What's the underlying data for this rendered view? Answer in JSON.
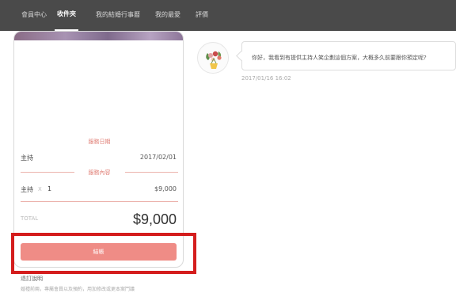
{
  "nav": {
    "items": [
      {
        "label": "會員中心"
      },
      {
        "label": "收件夾"
      },
      {
        "label": "我的結婚行事曆"
      },
      {
        "label": "我的最愛"
      },
      {
        "label": "評價"
      }
    ],
    "active_index": 1
  },
  "order": {
    "service_date_heading": "服務日期",
    "service_type": "主持",
    "service_date": "2017/02/01",
    "service_content_heading": "服務內容",
    "item_name": "主持",
    "qty_symbol": "X",
    "qty": "1",
    "item_price": "$9,000",
    "total_label": "TOTAL",
    "total_value": "$9,000",
    "checkout_label": "結帳"
  },
  "notes": {
    "title": "退訂說明",
    "text": "婚禮前兩，專屬會員以及預約，用加修改或更本案鬥議"
  },
  "message": {
    "text": "你好，我看到有提供主持人笑企劃這個方案，大概多久前要跟你預定呢?",
    "time": "2017/01/16 16:02"
  },
  "colors": {
    "accent": "#ef8c86",
    "nav_bg": "#4a4a4a",
    "highlight": "#d41d1d"
  }
}
